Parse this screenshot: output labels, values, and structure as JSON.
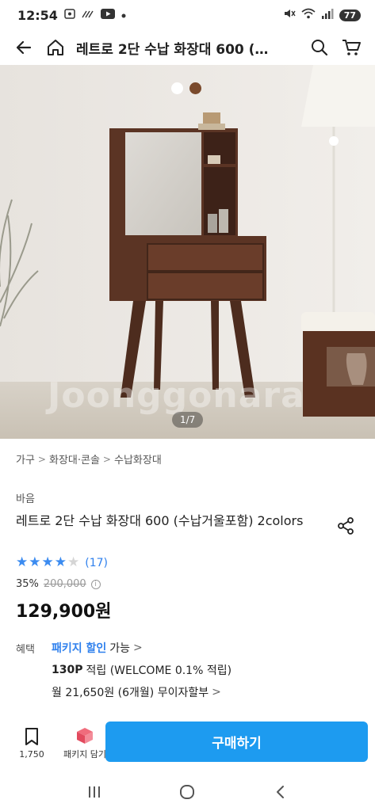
{
  "status_bar": {
    "time": "12:54",
    "battery": "77",
    "left_icons": [
      "screenshot-icon",
      "call-forward-icon",
      "youtube-icon",
      "dot-icon"
    ],
    "right_icons": [
      "mute-icon",
      "wifi-icon",
      "signal-icon"
    ]
  },
  "header": {
    "title": "레트로 2단 수납 화장대 600 (…",
    "icons": [
      "back-icon",
      "home-icon",
      "search-icon",
      "cart-icon"
    ]
  },
  "gallery": {
    "counter": "1/7",
    "watermark": "Joonggonara",
    "color_options": [
      "#ffffff",
      "#7a4a2c"
    ]
  },
  "breadcrumb": [
    "가구",
    "화장대·콘솔",
    "수납화장대"
  ],
  "product": {
    "brand": "바음",
    "name": "레트로 2단 수납 화장대 600 (수납거울포함) 2colors",
    "rating": 4,
    "rating_max": 5,
    "review_count": "(17)",
    "discount": "35%",
    "original_price": "200,000",
    "price": "129,900원"
  },
  "benefits": {
    "label": "혜택",
    "package_link": "패키지 할인",
    "package_suffix": "가능",
    "points_amount": "130P",
    "points_text": "적립 (WELCOME 0.1% 적립)",
    "installment": "월 21,650원 (6개월) 무이자할부"
  },
  "bottom_bar": {
    "bookmark_count": "1,750",
    "package_label": "패키지 담기",
    "buy_label": "구매하기"
  },
  "colors": {
    "accent": "#1d9bf0",
    "star": "#3b8bf0",
    "link": "#2f80ed"
  }
}
